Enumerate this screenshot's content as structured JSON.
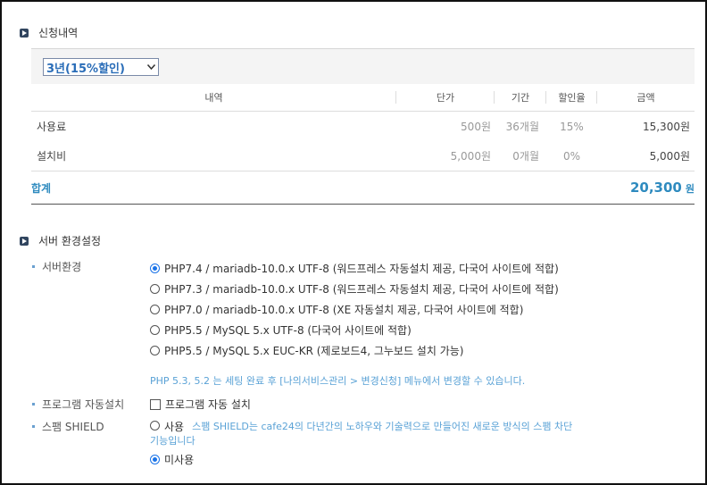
{
  "order_section": {
    "title": "신청내역",
    "period_select": "3년(15%할인)",
    "columns": [
      "내역",
      "단가",
      "기간",
      "할인율",
      "금액"
    ],
    "rows": [
      {
        "name": "사용료",
        "price": "500원",
        "period": "36개월",
        "discount": "15%",
        "amount": "15,300원"
      },
      {
        "name": "설치비",
        "price": "5,000원",
        "period": "0개월",
        "discount": "0%",
        "amount": "5,000원"
      }
    ],
    "total": {
      "label": "합계",
      "amount": "20,300",
      "unit": "원"
    }
  },
  "server_section": {
    "title": "서버 환경설정",
    "env_label": "서버환경",
    "env_options": [
      {
        "label": "PHP7.4 / mariadb-10.0.x UTF-8 (워드프레스 자동설치 제공, 다국어 사이트에 적합)",
        "selected": true
      },
      {
        "label": "PHP7.3 / mariadb-10.0.x UTF-8 (워드프레스 자동설치 제공, 다국어 사이트에 적합)",
        "selected": false
      },
      {
        "label": "PHP7.0 / mariadb-10.0.x UTF-8 (XE 자동설치 제공, 다국어 사이트에 적합)",
        "selected": false
      },
      {
        "label": "PHP5.5 / MySQL 5.x UTF-8 (다국어 사이트에 적합)",
        "selected": false
      },
      {
        "label": "PHP5.5 / MySQL 5.x EUC-KR (제로보드4, 그누보드 설치 가능)",
        "selected": false
      }
    ],
    "env_note": "PHP 5.3, 5.2 는 세팅 완료 후 [나의서비스관리 > 변경신청] 메뉴에서 변경할 수 있습니다.",
    "program_label": "프로그램 자동설치",
    "program_checkbox": "프로그램 자동 설치",
    "spam_label": "스팸 SHIELD",
    "spam_use": "사용",
    "spam_desc_1": "스팸 SHIELD는 cafe24의 다년간의 노하우와 기술력으로 만들어진 새로운 방식의 스팸 차단",
    "spam_desc_2": "기능입니다",
    "spam_nouse": "미사용"
  }
}
